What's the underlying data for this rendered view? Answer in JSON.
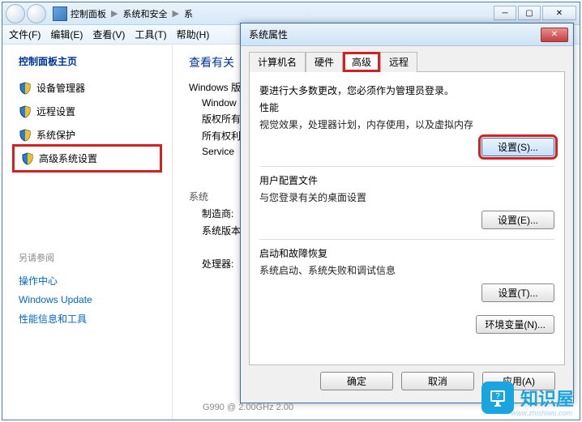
{
  "window": {
    "breadcrumb": [
      "控制面板",
      "系统和安全",
      "系"
    ]
  },
  "menu": {
    "file": "文件(F)",
    "edit": "编辑(E)",
    "view": "查看(V)",
    "tools": "工具(T)",
    "help": "帮助(H)"
  },
  "sidebar": {
    "title": "控制面板主页",
    "items": [
      {
        "label": "设备管理器"
      },
      {
        "label": "远程设置"
      },
      {
        "label": "系统保护"
      },
      {
        "label": "高级系统设置"
      }
    ],
    "see_also_title": "另请参阅",
    "see_also": [
      "操作中心",
      "Windows Update",
      "性能信息和工具"
    ]
  },
  "main": {
    "title": "查看有关",
    "windows_label": "Windows 版",
    "windows_sub": "Window",
    "copyright": "版权所有",
    "rights": "所有权利",
    "service": "Service",
    "system_label": "系统",
    "manufacturer": "制造商:",
    "version": "系统版本",
    "processor": "处理器:"
  },
  "dialog": {
    "title": "系统属性",
    "tabs": [
      "计算机名",
      "硬件",
      "高级",
      "远程"
    ],
    "admin_note": "要进行大多数更改，您必须作为管理员登录。",
    "perf": {
      "title": "性能",
      "desc": "视觉效果，处理器计划，内存使用，以及虚拟内存",
      "btn": "设置(S)..."
    },
    "profile": {
      "title": "用户配置文件",
      "desc": "与您登录有关的桌面设置",
      "btn": "设置(E)..."
    },
    "startup": {
      "title": "启动和故障恢复",
      "desc": "系统启动、系统失败和调试信息",
      "btn": "设置(T)..."
    },
    "env_btn": "环境变量(N)...",
    "ok": "确定",
    "cancel": "取消",
    "apply": "应用(A)"
  },
  "status": "G990 @ 2.00GHz  2.00",
  "watermark": {
    "text": "知识屋",
    "url": "www.zhishiwu.com"
  }
}
